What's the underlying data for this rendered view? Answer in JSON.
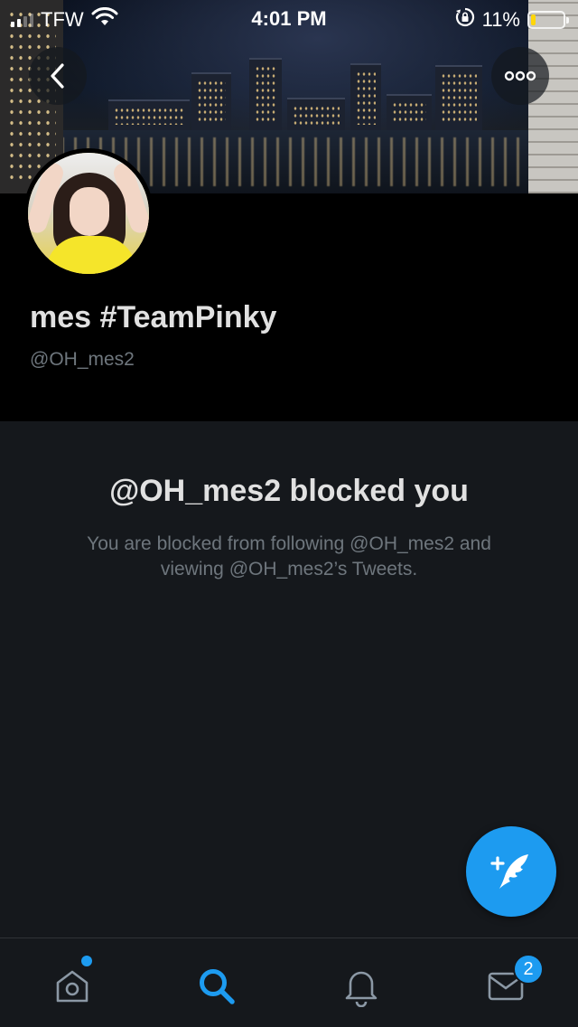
{
  "status_bar": {
    "carrier": "TFW",
    "time": "4:01 PM",
    "battery_percent": "11%",
    "battery_level": 0.11,
    "icons": [
      "signal-icon",
      "wifi-icon",
      "orientation-lock-icon",
      "battery-icon"
    ]
  },
  "header": {
    "back_icon": "chevron-left-icon",
    "more_icon": "more-horizontal-icon"
  },
  "profile": {
    "display_name": "mes #TeamPinky",
    "handle": "@OH_mes2"
  },
  "blocked": {
    "title": "@OH_mes2 blocked you",
    "description": "You are blocked from following @OH_mes2 and viewing @OH_mes2’s Tweets."
  },
  "fab": {
    "icon": "compose-tweet-icon",
    "plus": "+"
  },
  "tab_bar": {
    "tabs": [
      {
        "icon": "home-icon",
        "has_dot": true
      },
      {
        "icon": "search-icon",
        "active": true
      },
      {
        "icon": "bell-icon"
      },
      {
        "icon": "mail-icon",
        "badge": "2"
      }
    ]
  },
  "colors": {
    "accent": "#1d9bf0",
    "background": "#15181c",
    "profile_bg": "#000000",
    "muted_text": "#6e767d",
    "primary_text": "#e1e1e1"
  }
}
